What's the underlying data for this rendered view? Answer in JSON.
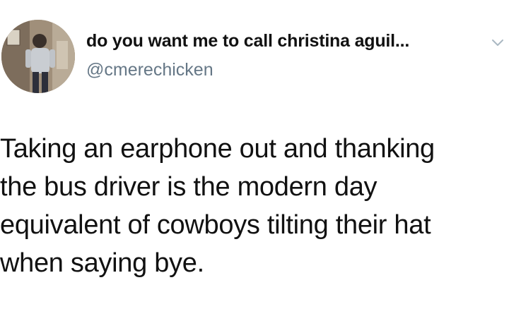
{
  "tweet": {
    "author": {
      "display_name": "do you want me to call christina aguil...",
      "handle": "@cmerechicken",
      "avatar_icon": "profile-photo"
    },
    "menu_icon": "chevron-down-icon",
    "text_lines": [
      "Taking an earphone out and thanking",
      "the bus driver is the modern day",
      "equivalent of cowboys tilting their hat",
      "when saying bye."
    ]
  },
  "colors": {
    "text": "#111111",
    "handle": "#657786",
    "background": "#ffffff"
  }
}
